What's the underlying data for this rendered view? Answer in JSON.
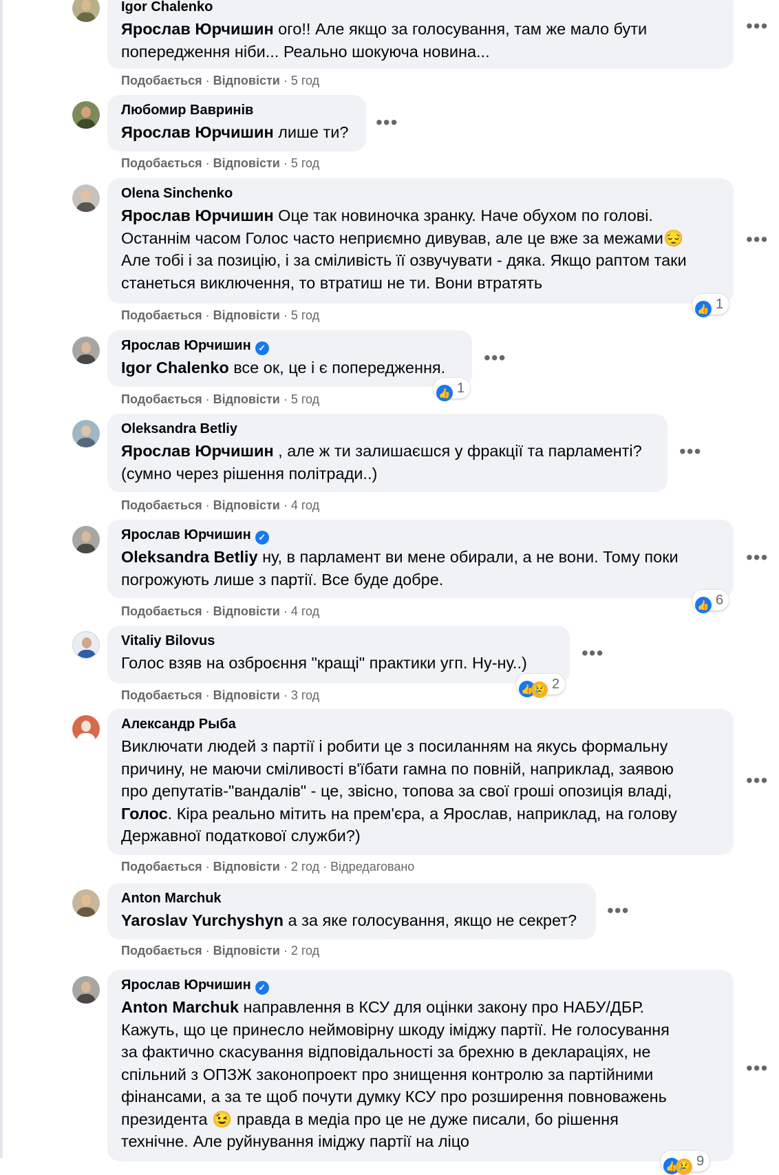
{
  "ui": {
    "like_label": "Подобається",
    "reply_label": "Відповісти",
    "separator": "·",
    "more_label": "•••",
    "verified_mark": "✓",
    "like_icon": "👍",
    "sad_icon": "😢",
    "colors": {
      "bubble": "#f0f2f5",
      "secondary_text": "#65676b",
      "like_blue": "#1877f2"
    }
  },
  "comments": [
    {
      "author": "Igor Chalenko",
      "mention": "Ярослав Юрчишин",
      "line1_rest": " ого!! Але якщо за голосування, там же мало бути",
      "line2": "попередження ніби... Реально шокуюча новина...",
      "time": "5 год"
    },
    {
      "author": "Любомир Вавринів",
      "mention": "Ярослав Юрчишин",
      "line1_rest": " лише ти?",
      "time": "5 год"
    },
    {
      "author": "Olena Sinchenko",
      "mention": "Ярослав Юрчишин",
      "line1_rest": " Оце так новиночка зранку. Наче обухом по голові.",
      "line2": "Останнім часом Голос часто неприємно дивував, але це вже за межами😔",
      "line3": "Але тобі і за позицію, і за сміливість її озвучувати - дяка. Якщо раптом таки",
      "line4": "станеться виключення, то втратиш не ти. Вони втратять",
      "reactions": "1",
      "time": "5 год"
    },
    {
      "author": "Ярослав Юрчишин",
      "mention": "Igor Chalenko",
      "line1_rest": " все ок, це і є попередження.",
      "reactions": "1",
      "time": "5 год"
    },
    {
      "author": "Oleksandra Betliy",
      "mention": "Ярослав Юрчишин",
      "line1_rest": " , але ж ти залишаєшся у фракції та парламенті?",
      "line2": "(сумно через рішення політради..)",
      "time": "4 год"
    },
    {
      "author": "Ярослав Юрчишин",
      "mention": "Oleksandra Betliy",
      "line1_rest": " ну, в парламент ви мене обирали, а не вони. Тому поки",
      "line2": "погрожують лише з партії. Все буде добре.",
      "reactions": "6",
      "time": "4 год"
    },
    {
      "author": "Vitaliy Bilovus",
      "line1": "Голос взяв на озброєння \"кращі\" практики угп. Ну-ну..)",
      "reactions": "2",
      "time": "3 год"
    },
    {
      "author": "Александр Рыба",
      "line1": "Виключати людей з партії і робити це з посиланням на якусь формальну",
      "line2": "причину, не маючи сміливості в'їбати гамна по повній, наприклад, заявою",
      "line3": "про депутатів-\"вандалів\" - це, звісно, топова за свої гроші опозиція владі,",
      "line4_bold": "Голос",
      "line4_rest": ". Кіра реально мітить на прем'єра, а Ярослав, наприклад, на голову",
      "line5": "Державної податкової служби?)",
      "time": "2 год",
      "edited": "Відредаговано"
    },
    {
      "author": "Anton Marchuk",
      "mention": "Yaroslav Yurchyshyn",
      "line1_rest": " а за яке голосування, якщо не секрет?",
      "time": "2 год"
    },
    {
      "author": "Ярослав Юрчишин",
      "mention": "Anton Marchuk",
      "line1_rest": " направлення в КСУ для оцінки закону про НАБУ/ДБР.",
      "line2": "Кажуть, що це принесло неймовірну шкоду іміджу партії. Не голосування",
      "line3": "за фактично скасування відповідальності за брехню в деклараціях, не",
      "line4": "спільний з ОПЗЖ законопроект про знищення контролю за партійними",
      "line5": "фінансами, а за те щоб почути думку КСУ про розширення повноважень",
      "line6": "президента 😉 правда в медіа про це не дуже писали, бо рішення",
      "line7": "технічне. Але руйнування іміджу партії на ліцо",
      "reactions": "9"
    }
  ]
}
